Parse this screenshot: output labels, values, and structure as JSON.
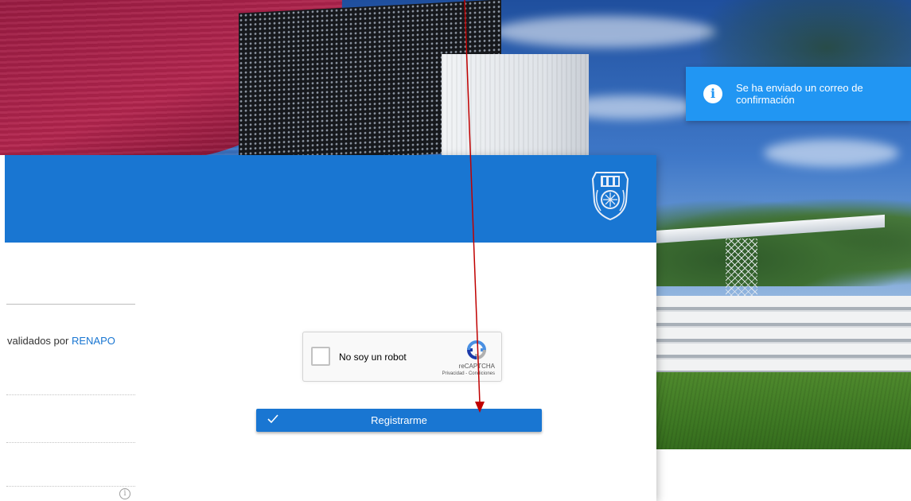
{
  "toast": {
    "icon": "info-icon",
    "message": "Se ha enviado un correo de confirmación"
  },
  "header": {
    "logo": "ipn-logo"
  },
  "form": {
    "renapo_prefix": "validados por ",
    "renapo_link": "RENAPO",
    "info_icon": "info-circle-icon"
  },
  "recaptcha": {
    "label": "No soy un robot",
    "brand": "reCAPTCHA",
    "terms": "Privacidad - Condiciones"
  },
  "submit": {
    "icon": "check-icon",
    "label": "Registrarme"
  },
  "colors": {
    "primary": "#1976d2",
    "toast": "#2196f3",
    "arrow": "#c00000"
  }
}
